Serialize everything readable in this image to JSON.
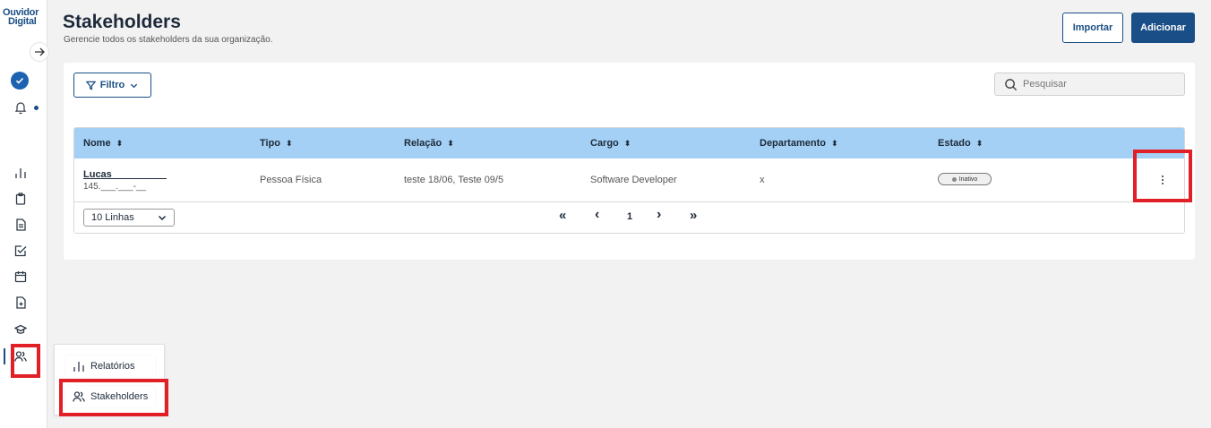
{
  "brand": {
    "line1": "Ouvidor",
    "line2": "Digital"
  },
  "header": {
    "title": "Stakeholders",
    "subtitle": "Gerencie todos os stakeholders da sua organização.",
    "import_label": "Importar",
    "add_label": "Adicionar"
  },
  "toolbar": {
    "filter_label": "Filtro",
    "search_placeholder": "Pesquisar"
  },
  "table": {
    "columns": [
      "Nome",
      "Tipo",
      "Relação",
      "Cargo",
      "Departamento",
      "Estado"
    ],
    "rows": [
      {
        "name": "Lucas ___ ______",
        "document": "145.___.___-__",
        "tipo": "Pessoa Física",
        "relacao": "teste 18/06, Teste 09/5",
        "cargo": "Software Developer",
        "departamento": "x",
        "estado": "Inativo"
      }
    ]
  },
  "pagination": {
    "rows_per_page": "10 Linhas",
    "first": "«",
    "prev": "‹",
    "current_page": "1",
    "next": "›",
    "last": "»"
  },
  "flyout": {
    "items": [
      {
        "label": "Relatórios",
        "icon": "bar-chart-icon"
      },
      {
        "label": "Stakeholders",
        "icon": "users-icon"
      }
    ]
  },
  "sidebar": {
    "icons": [
      "arrow-right-icon",
      "verified-badge-icon",
      "bell-icon",
      "bar-chart-icon",
      "clipboard-icon",
      "document-icon",
      "checkbox-icon",
      "calendar-icon",
      "file-plus-icon",
      "graduation-cap-icon",
      "users-icon"
    ]
  },
  "colors": {
    "primary": "#1a4e86",
    "table_header": "#a3d0f4",
    "highlight": "#e01f26",
    "background": "#f2f2f2"
  }
}
